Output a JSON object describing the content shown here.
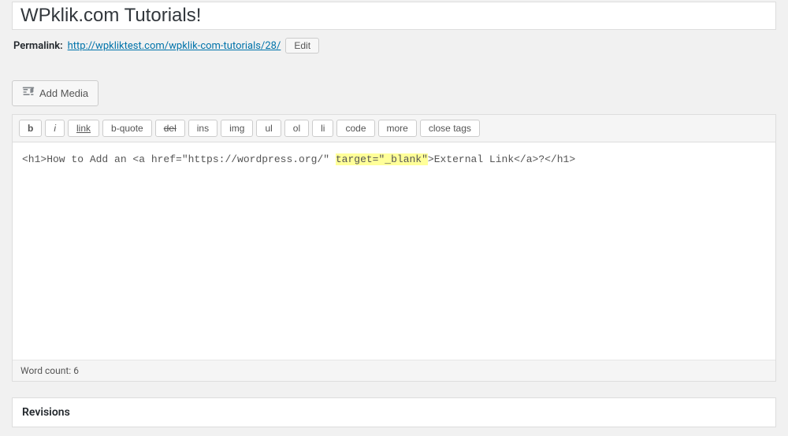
{
  "title": "WPklik.com Tutorials!",
  "permalink": {
    "label": "Permalink:",
    "url_prefix": "http://wpkliktest.com/",
    "slug": "wpklik-com-tutorials",
    "url_suffix": "/28/",
    "edit_label": "Edit"
  },
  "media_button": "Add Media",
  "toolbar": {
    "b": "b",
    "i": "i",
    "link": "link",
    "bquote": "b-quote",
    "del": "del",
    "ins": "ins",
    "img": "img",
    "ul": "ul",
    "ol": "ol",
    "li": "li",
    "code": "code",
    "more": "more",
    "close": "close tags"
  },
  "content": {
    "seg1": "<h1>How to Add an <a href=\"https://wordpress.org/\" ",
    "highlight": "target=\"_blank\"",
    "seg2": ">External Link</a>?</h1>"
  },
  "status": {
    "word_count_label": "Word count: ",
    "word_count_value": "6"
  },
  "revisions_title": "Revisions"
}
